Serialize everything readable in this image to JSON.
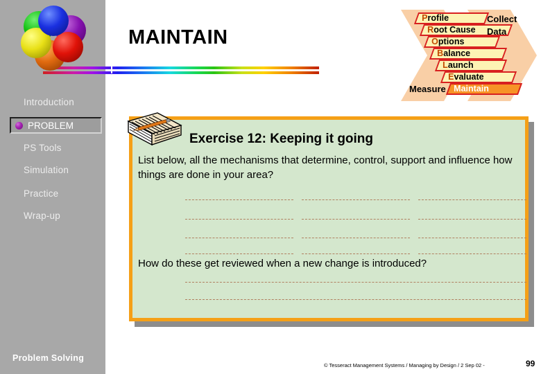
{
  "slide": {
    "title": "MAINTAIN",
    "brand_bottom": "Problem Solving",
    "footer": "© Tesseract Management Systems / Managing by Design / 2 Sep 02  -",
    "page_number": "99"
  },
  "logo": {
    "name": "six-sphere-logo",
    "spheres": [
      "blue",
      "purple",
      "red",
      "orange",
      "yellow",
      "green"
    ],
    "colors": {
      "blue": "#1a30e0",
      "purple": "#8611b0",
      "red": "#e01208",
      "orange": "#e06a10",
      "yellow": "#e8e016",
      "green": "#10c010"
    }
  },
  "sidebar": {
    "background": "#a8a8a8",
    "items": [
      {
        "label": "Introduction",
        "active": false
      },
      {
        "label": "PROBLEM",
        "active": true
      },
      {
        "label": "PS Tools",
        "active": false
      },
      {
        "label": "Simulation",
        "active": false
      },
      {
        "label": "Practice",
        "active": false
      },
      {
        "label": "Wrap-up",
        "active": false
      }
    ],
    "active_bullet_color": "#a322b0"
  },
  "problem_chart": {
    "left_label": "Measure",
    "right_label_line1": "Collect",
    "right_label_line2": "Data",
    "highlight_color": "#f79326",
    "bar_fill": "#fdf3b4",
    "bar_border": "#d82020",
    "chevron_fill": "#f9cfa6",
    "steps": [
      {
        "cap": "P",
        "rest": "rofile",
        "highlighted": false
      },
      {
        "cap": "R",
        "rest": "oot Cause",
        "highlighted": false
      },
      {
        "cap": "O",
        "rest": "ptions",
        "highlighted": false
      },
      {
        "cap": "B",
        "rest": "alance",
        "highlighted": false
      },
      {
        "cap": "L",
        "rest": "aunch",
        "highlighted": false
      },
      {
        "cap": "E",
        "rest": "valuate",
        "highlighted": false
      },
      {
        "cap": "M",
        "rest": "aintain",
        "highlighted": true
      }
    ]
  },
  "exercise": {
    "icon": "notepad-pencil-icon",
    "title": "Exercise 12: Keeping it going",
    "question_1": "List below, all the mechanisms that determine, control, support and influence how things are done in your area?",
    "question_2": "How do these get reviewed when a new change is introduced?",
    "answer_grid": {
      "columns": 3,
      "rows": 4
    },
    "answer_wide_lines": 2,
    "panel_background": "#d4e7cd",
    "panel_border": "#f5a017"
  }
}
